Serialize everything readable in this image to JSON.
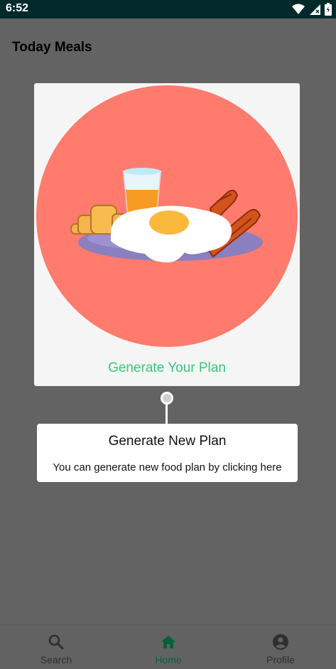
{
  "status_bar": {
    "time": "6:52",
    "icons": [
      "wifi-icon",
      "signal-icon",
      "battery-icon"
    ]
  },
  "app": {
    "title": "Today Meals"
  },
  "card": {
    "image": "breakfast-illustration",
    "caption": "Generate Your Plan",
    "caption_color": "#35c77c",
    "circle_color": "#fe7b6d"
  },
  "tooltip": {
    "title": "Generate New Plan",
    "description": "You can generate new food plan by clicking here"
  },
  "bottom_nav": {
    "items": [
      {
        "label": "Search",
        "icon": "search-icon",
        "active": false
      },
      {
        "label": "Home",
        "icon": "home-icon",
        "active": true
      },
      {
        "label": "Profile",
        "icon": "profile-icon",
        "active": false
      }
    ]
  },
  "colors": {
    "status_bar": "#032a2b",
    "overlay_background": "#636363",
    "active_nav": "#07603d"
  }
}
